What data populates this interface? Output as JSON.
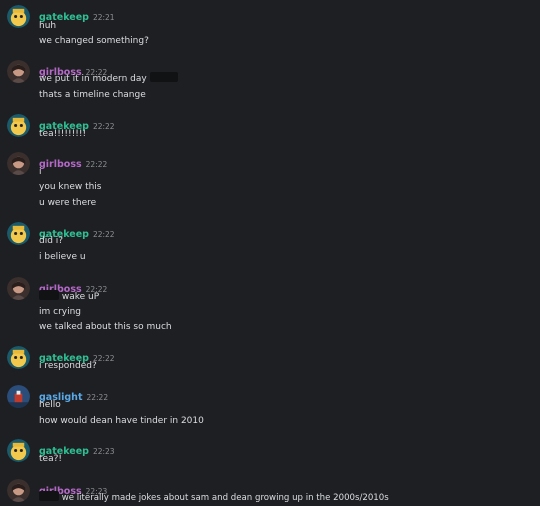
{
  "colors": {
    "background": "#1e1f22",
    "gatekeep": "#2fbf94",
    "girlboss": "#b469c8",
    "gaslight": "#5aa9e6",
    "text": "#dbdee1",
    "timestamp": "#8c8f95"
  },
  "messages": [
    {
      "author": "gatekeep",
      "time": "22:21",
      "lines": [
        "huh",
        "we changed something?"
      ]
    },
    {
      "author": "girlboss",
      "time": "22:22",
      "lines": [
        "we put it in modern day",
        "thats a timeline change"
      ]
    },
    {
      "author": "gatekeep",
      "time": "22:22",
      "lines": [
        "tea!!!!!!!!!"
      ]
    },
    {
      "author": "girlboss",
      "time": "22:22",
      "lines": [
        "i",
        "you knew this",
        "u were there"
      ]
    },
    {
      "author": "gatekeep",
      "time": "22:22",
      "lines": [
        "did i?",
        "i believe u"
      ]
    },
    {
      "author": "girlboss",
      "time": "22:22",
      "lines": [
        "wake uP",
        "im crying",
        "we talked about this so much"
      ]
    },
    {
      "author": "gatekeep",
      "time": "22:22",
      "lines": [
        "i responded?"
      ]
    },
    {
      "author": "gaslight",
      "time": "22:22",
      "lines": [
        "hello",
        "how would dean have tinder in 2010"
      ]
    },
    {
      "author": "gatekeep",
      "time": "22:23",
      "lines": [
        "tea?!"
      ]
    },
    {
      "author": "girlboss",
      "time": "22:23",
      "lines": [
        "we literally made jokes about sam and dean growing up in the 2000s/2010s"
      ]
    }
  ]
}
